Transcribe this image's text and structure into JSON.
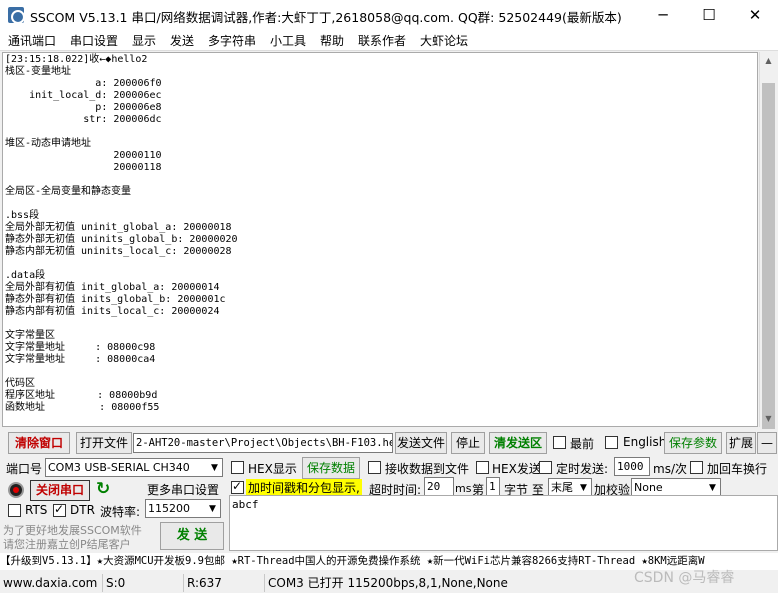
{
  "window": {
    "title": "SSCOM V5.13.1 串口/网络数据调试器,作者:大虾丁丁,2618058@qq.com. QQ群: 52502449(最新版本)",
    "minimize": "─",
    "maximize": "☐",
    "close": "✕"
  },
  "menu": [
    "通讯端口",
    "串口设置",
    "显示",
    "发送",
    "多字符串",
    "小工具",
    "帮助",
    "联系作者",
    "大虾论坛"
  ],
  "receive": {
    "lines": [
      "[23:15:18.022]收←◆hello2",
      "栈区-变量地址",
      "               a: 200006f0",
      "    init_local_d: 200006ec",
      "               p: 200006e8",
      "             str: 200006dc",
      "",
      "堆区-动态申请地址",
      "                  20000110",
      "                  20000118",
      "",
      "全局区-全局变量和静态变量",
      "",
      ".bss段",
      "全局外部无初值 uninit_global_a: 20000018",
      "静态外部无初值 uninits_global_b: 20000020",
      "静态内部无初值 uninits_local_c: 20000028",
      "",
      ".data段",
      "全局外部有初值 init_global_a: 20000014",
      "静态外部有初值 inits_global_b: 2000001c",
      "静态内部有初值 inits_local_c: 20000024",
      "",
      "文字常量区",
      "文字常量地址     : 08000c98",
      "文字常量地址     : 08000ca4",
      "",
      "代码区",
      "程序区地址       : 08000b9d",
      "函数地址         : 08000f55"
    ]
  },
  "toolbar": {
    "clear_window": "清除窗口",
    "open_file": "打开文件",
    "file_path": "2-AHT20-master\\Project\\Objects\\BH-F103.hex",
    "send_file": "发送文件",
    "stop": "停止",
    "clear_send": "清发送区",
    "topmost": "最前",
    "english": "English",
    "save_params": "保存参数",
    "expand": "扩展",
    "dash": "—"
  },
  "port": {
    "label": "端口号",
    "value": "COM3 USB-SERIAL CH340",
    "close_port": "关闭串口",
    "more_settings": "更多串口设置",
    "rts": "RTS",
    "dtr": "DTR",
    "baud_label": "波特率:",
    "baud": "115200"
  },
  "options": {
    "hex_display": "HEX显示",
    "save_data": "保存数据",
    "recv_to_file": "接收数据到文件",
    "hex_send": "HEX发送",
    "timed_send": "定时发送:",
    "interval": "1000",
    "interval_unit": "ms/次",
    "add_newline": "加回车换行",
    "add_timestamp": "加时间戳和分包显示,",
    "timeout_label": "超时时间:",
    "timeout": "20",
    "timeout_unit": "ms",
    "nth_label": "第",
    "nth": "1",
    "byte_label": "字节 至",
    "to_value": "末尾",
    "checksum_label": "加校验",
    "checksum": "None"
  },
  "promo": {
    "line1": "为了更好地发展SSCOM软件",
    "line2": "请您注册嘉立创P结尾客户"
  },
  "send": {
    "button": "发 送",
    "text": "abcf"
  },
  "ticker": "【升级到V5.13.1】★大资源MCU开发板9.9包邮 ★RT-Thread中国人的开源免费操作系统 ★新一代WiFi芯片兼容8266支持RT-Thread ★8KM远距离W",
  "status": {
    "website": "www.daxia.com",
    "sent": "S:0",
    "received": "R:637",
    "port_status": "COM3 已打开  115200bps,8,1,None,None"
  },
  "watermark": "CSDN @马睿睿",
  "icons": [
    "app-logo-icon",
    "scroll-up-icon",
    "scroll-down-icon",
    "port-status-icon",
    "refresh-icon",
    "dropdown-arrow-icon"
  ],
  "colors": {
    "red": "#c00000",
    "green": "#008000",
    "highlight": "#ffff00"
  }
}
